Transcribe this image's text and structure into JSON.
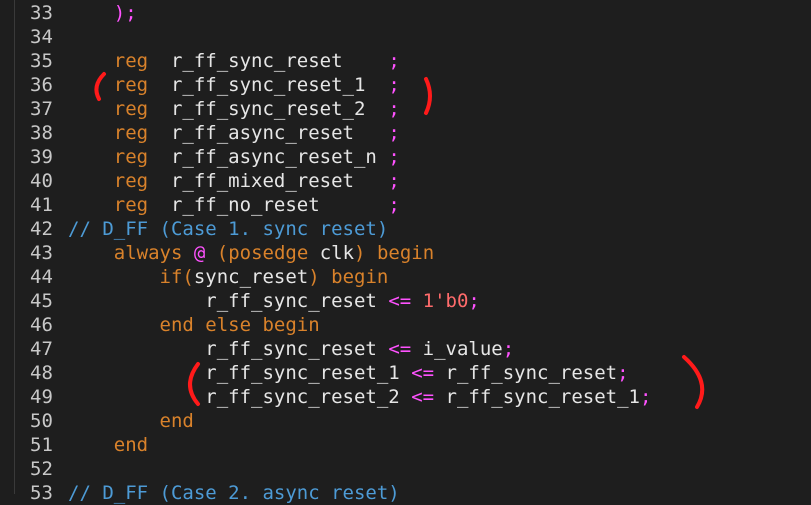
{
  "editor": {
    "colors": {
      "background": "#1e1e1e",
      "line_number": "#c8c8c8",
      "keyword": "#d9822b",
      "identifier": "#e6e6e6",
      "operator": "#ff52ff",
      "comment": "#4d9bd6",
      "number": "#ff6b6b",
      "annotation": "#ff1a1a"
    },
    "lines": [
      {
        "n": "33",
        "tokens": [
          {
            "t": "    ",
            "c": "text"
          },
          {
            "t": ");",
            "c": "op"
          }
        ]
      },
      {
        "n": "34",
        "tokens": []
      },
      {
        "n": "35",
        "tokens": [
          {
            "t": "    ",
            "c": "text"
          },
          {
            "t": "reg",
            "c": "kw"
          },
          {
            "t": "  r_ff_sync_reset    ",
            "c": "id"
          },
          {
            "t": ";",
            "c": "op"
          }
        ]
      },
      {
        "n": "36",
        "tokens": [
          {
            "t": "    ",
            "c": "text"
          },
          {
            "t": "reg",
            "c": "kw"
          },
          {
            "t": "  r_ff_sync_reset_1  ",
            "c": "id"
          },
          {
            "t": ";",
            "c": "op"
          }
        ]
      },
      {
        "n": "37",
        "tokens": [
          {
            "t": "    ",
            "c": "text"
          },
          {
            "t": "reg",
            "c": "kw"
          },
          {
            "t": "  r_ff_sync_reset_2  ",
            "c": "id"
          },
          {
            "t": ";",
            "c": "op"
          }
        ]
      },
      {
        "n": "38",
        "tokens": [
          {
            "t": "    ",
            "c": "text"
          },
          {
            "t": "reg",
            "c": "kw"
          },
          {
            "t": "  r_ff_async_reset   ",
            "c": "id"
          },
          {
            "t": ";",
            "c": "op"
          }
        ]
      },
      {
        "n": "39",
        "tokens": [
          {
            "t": "    ",
            "c": "text"
          },
          {
            "t": "reg",
            "c": "kw"
          },
          {
            "t": "  r_ff_async_reset_n ",
            "c": "id"
          },
          {
            "t": ";",
            "c": "op"
          }
        ]
      },
      {
        "n": "40",
        "tokens": [
          {
            "t": "    ",
            "c": "text"
          },
          {
            "t": "reg",
            "c": "kw"
          },
          {
            "t": "  r_ff_mixed_reset   ",
            "c": "id"
          },
          {
            "t": ";",
            "c": "op"
          }
        ]
      },
      {
        "n": "41",
        "tokens": [
          {
            "t": "    ",
            "c": "text"
          },
          {
            "t": "reg",
            "c": "kw"
          },
          {
            "t": "  r_ff_no_reset      ",
            "c": "id"
          },
          {
            "t": ";",
            "c": "op"
          }
        ]
      },
      {
        "n": "42",
        "tokens": [
          {
            "t": "// D_FF (Case 1. sync reset)",
            "c": "cmt"
          }
        ]
      },
      {
        "n": "43",
        "tokens": [
          {
            "t": "    ",
            "c": "text"
          },
          {
            "t": "always",
            "c": "kw"
          },
          {
            "t": " ",
            "c": "text"
          },
          {
            "t": "@",
            "c": "op"
          },
          {
            "t": " (",
            "c": "kw"
          },
          {
            "t": "posedge",
            "c": "kw"
          },
          {
            "t": " clk",
            "c": "id"
          },
          {
            "t": ")",
            "c": "kw"
          },
          {
            "t": " begin",
            "c": "kw"
          }
        ]
      },
      {
        "n": "44",
        "tokens": [
          {
            "t": "        ",
            "c": "text"
          },
          {
            "t": "if",
            "c": "kw"
          },
          {
            "t": "(",
            "c": "kw"
          },
          {
            "t": "sync_reset",
            "c": "id"
          },
          {
            "t": ")",
            "c": "kw"
          },
          {
            "t": " begin",
            "c": "kw"
          }
        ]
      },
      {
        "n": "45",
        "tokens": [
          {
            "t": "            ",
            "c": "text"
          },
          {
            "t": "r_ff_sync_reset ",
            "c": "id"
          },
          {
            "t": "<=",
            "c": "op"
          },
          {
            "t": " ",
            "c": "text"
          },
          {
            "t": "1'b0",
            "c": "num"
          },
          {
            "t": ";",
            "c": "op"
          }
        ]
      },
      {
        "n": "46",
        "tokens": [
          {
            "t": "        ",
            "c": "text"
          },
          {
            "t": "end else begin",
            "c": "kw"
          }
        ]
      },
      {
        "n": "47",
        "tokens": [
          {
            "t": "            ",
            "c": "text"
          },
          {
            "t": "r_ff_sync_reset ",
            "c": "id"
          },
          {
            "t": "<=",
            "c": "op"
          },
          {
            "t": " i_value",
            "c": "id"
          },
          {
            "t": ";",
            "c": "op"
          }
        ]
      },
      {
        "n": "48",
        "tokens": [
          {
            "t": "            ",
            "c": "text"
          },
          {
            "t": "r_ff_sync_reset_1 ",
            "c": "id"
          },
          {
            "t": "<=",
            "c": "op"
          },
          {
            "t": " r_ff_sync_reset",
            "c": "id"
          },
          {
            "t": ";",
            "c": "op"
          }
        ]
      },
      {
        "n": "49",
        "tokens": [
          {
            "t": "            ",
            "c": "text"
          },
          {
            "t": "r_ff_sync_reset_2 ",
            "c": "id"
          },
          {
            "t": "<=",
            "c": "op"
          },
          {
            "t": " r_ff_sync_reset_1",
            "c": "id"
          },
          {
            "t": ";",
            "c": "op"
          }
        ]
      },
      {
        "n": "50",
        "tokens": [
          {
            "t": "        ",
            "c": "text"
          },
          {
            "t": "end",
            "c": "kw"
          }
        ]
      },
      {
        "n": "51",
        "tokens": [
          {
            "t": "    ",
            "c": "text"
          },
          {
            "t": "end",
            "c": "kw"
          }
        ]
      },
      {
        "n": "52",
        "tokens": []
      },
      {
        "n": "53",
        "tokens": [
          {
            "t": "// D_FF (Case 2. async reset)",
            "c": "cmt"
          }
        ]
      }
    ]
  }
}
